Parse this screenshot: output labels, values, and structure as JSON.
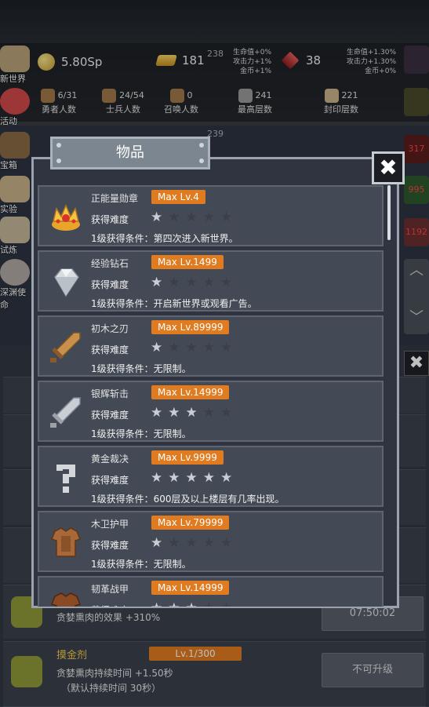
{
  "header": {
    "counter_a": "238",
    "counter_b": "239",
    "currency": "5.80Sp",
    "gold": "181",
    "gems": "38",
    "bonus_mid": [
      "生命值+0%",
      "攻击力+1%",
      "金币+1%"
    ],
    "bonus_right": [
      "生命值+1.30%",
      "攻击力+1.30%",
      "金币+0%"
    ]
  },
  "stats": [
    {
      "value": "6/31",
      "label": "勇者人数"
    },
    {
      "value": "24/54",
      "label": "士兵人数"
    },
    {
      "value": "0",
      "label": "召唤人数"
    },
    {
      "value": "241",
      "label": "最高层数"
    },
    {
      "value": "221",
      "label": "封印层数"
    }
  ],
  "left_menu": [
    "新世界",
    "活动",
    "宝箱",
    "实验",
    "试炼",
    "深渊使命"
  ],
  "right_badges": [
    "317",
    "995",
    "1192"
  ],
  "background_cards": [
    {
      "desc": "贪婪熏肉的效果 +310%",
      "button": "07:50:02"
    },
    {
      "title": "摸金剂",
      "level": "Lv.1/300",
      "desc1": "贪婪熏肉持续时间 +1.50秒",
      "desc2": "（默认持续时间 30秒）",
      "button": "不可升级"
    }
  ],
  "modal": {
    "title": "物品",
    "close_symbol": "✖",
    "difficulty_label": "获得难度",
    "items": [
      {
        "name": "正能量勋章",
        "max_level": "Max Lv.4",
        "stars": 1,
        "condition": "1级获得条件：第四次进入新世界。",
        "icon": "crown-medal-icon"
      },
      {
        "name": "经验钻石",
        "max_level": "Max Lv.1499",
        "stars": 1,
        "condition": "1级获得条件：开启新世界或观看广告。",
        "icon": "diamond-icon"
      },
      {
        "name": "初木之刃",
        "max_level": "Max Lv.89999",
        "stars": 1,
        "condition": "1级获得条件：无限制。",
        "icon": "wooden-sword-icon"
      },
      {
        "name": "银辉斩击",
        "max_level": "Max Lv.14999",
        "stars": 3,
        "condition": "1级获得条件：无限制。",
        "icon": "silver-sword-icon"
      },
      {
        "name": "黄金裁决",
        "max_level": "Max Lv.9999",
        "stars": 5,
        "condition": "1级获得条件：600层及以上楼层有几率出现。",
        "icon": "question-mark-icon"
      },
      {
        "name": "木卫护甲",
        "max_level": "Max Lv.79999",
        "stars": 1,
        "condition": "1级获得条件：无限制。",
        "icon": "wooden-armor-icon"
      },
      {
        "name": "韧革战甲",
        "max_level": "Max Lv.14999",
        "stars": 3,
        "condition": "",
        "icon": "leather-armor-icon"
      }
    ]
  }
}
